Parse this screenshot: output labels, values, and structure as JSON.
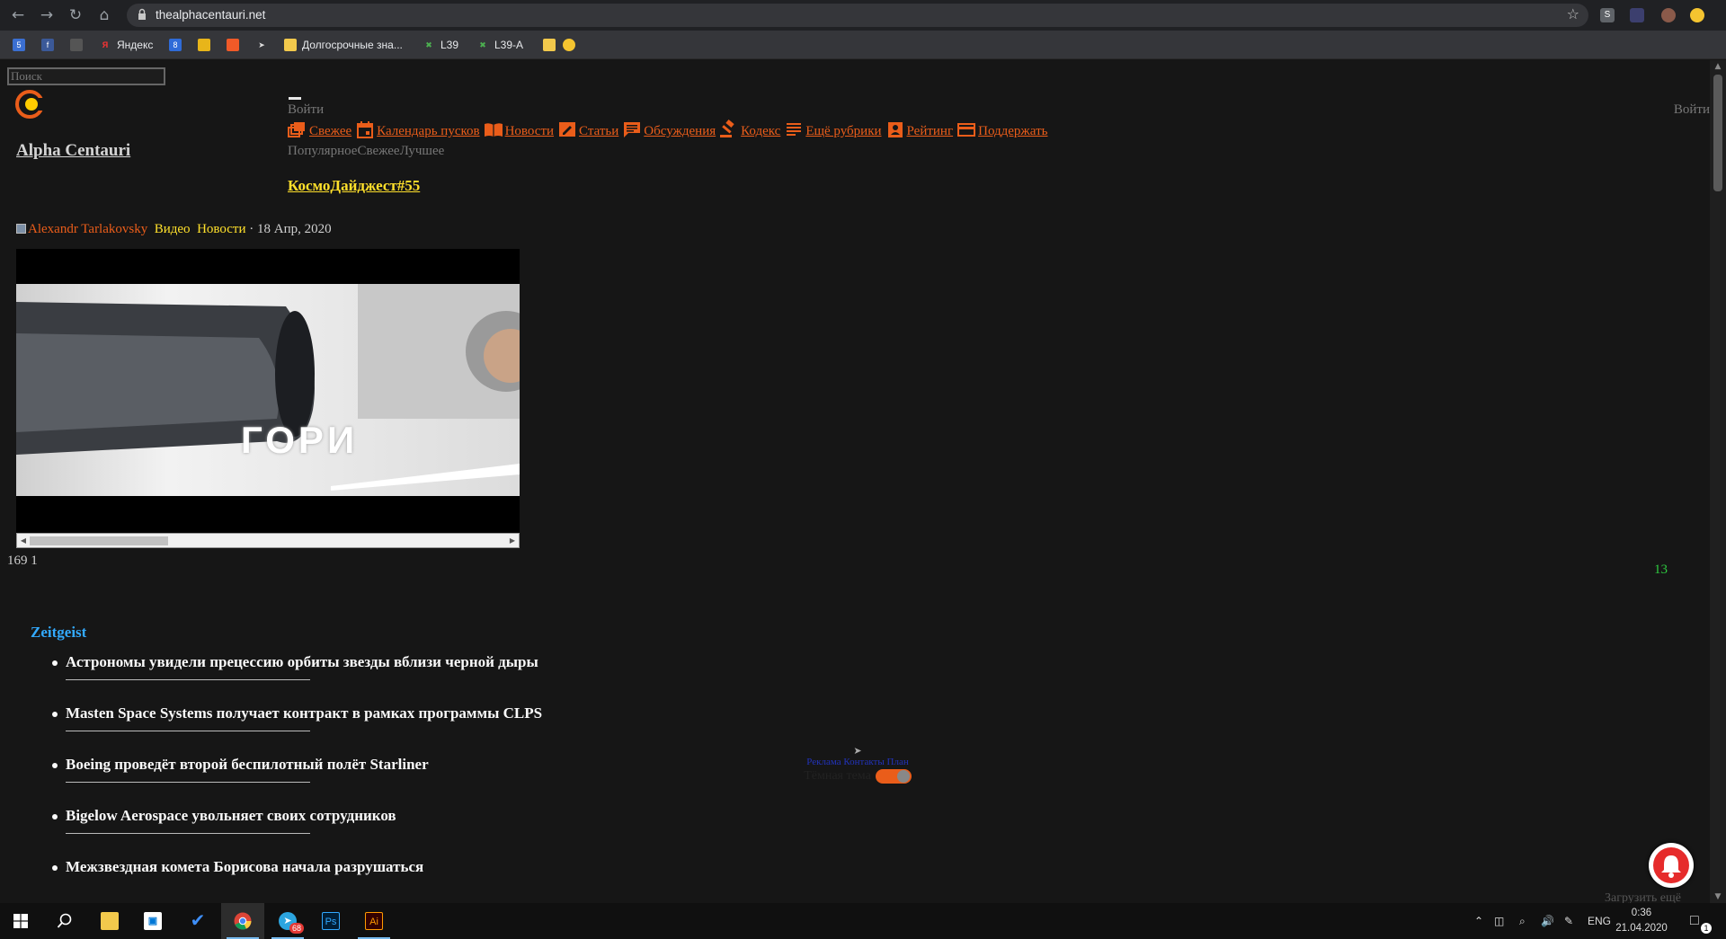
{
  "browser": {
    "url": "thealphacentauri.net",
    "bookmarks": [
      {
        "label": ""
      },
      {
        "label": ""
      },
      {
        "label": ""
      },
      {
        "label": "Яндекс"
      },
      {
        "label": ""
      },
      {
        "label": ""
      },
      {
        "label": ""
      },
      {
        "label": ""
      },
      {
        "label": "Долгосрочные зна..."
      },
      {
        "label": "L39"
      },
      {
        "label": "L39-A"
      },
      {
        "label": ""
      },
      {
        "label": ""
      }
    ]
  },
  "page": {
    "search_placeholder": "Поиск",
    "site_title": "Alpha Centauri",
    "login_left": "Войти",
    "login_right": "Войти",
    "nav": [
      {
        "label": " Свежее",
        "icon": "stack-icon"
      },
      {
        "label": " Календарь пусков",
        "icon": "calendar-icon"
      },
      {
        "label": " Новости",
        "icon": "book-icon"
      },
      {
        "label": " Статьи",
        "icon": "edit-icon"
      },
      {
        "label": " Обсуждения",
        "icon": "chat-icon"
      },
      {
        "label": " Кодекс",
        "icon": "gavel-icon"
      },
      {
        "label": " Ещё рубрики",
        "icon": "list-icon"
      },
      {
        "label": " Рейтинг",
        "icon": "badge-icon"
      },
      {
        "label": " Поддержать",
        "icon": "card-icon"
      }
    ],
    "sort_tabs": "ПопулярноеСвежееЛучшее",
    "article": {
      "title": "КосмоДайджест#55",
      "author": "Alexandr Tarlakovsky",
      "category_1": "Видео",
      "category_2": "Новости",
      "date_sep": " · 18 Апр, 2020",
      "video_text": "ГОРИ",
      "views": "169 ",
      "comments": "1",
      "counter": "13"
    },
    "zeitgeist": {
      "title": "Zeitgeist",
      "items": [
        "Астрономы увидели прецессию орбиты звезды вблизи черной дыры",
        "Masten Space Systems получает контракт в рамках программы CLPS",
        "Boeing проведёт второй беспилотный полёт Starliner",
        "Bigelow Aerospace увольняет своих сотрудников",
        "Межзвездная комета Борисова начала разрушаться"
      ]
    },
    "footer": {
      "links": [
        "Реклама",
        "Контакты",
        "План"
      ],
      "dark_theme": "Тёмная тема",
      "load_more": "Загрузить ещё"
    },
    "colors": {
      "accent": "#ea5d1a",
      "title_yellow": "#ffe02b",
      "zeitgeist_blue": "#33aaff",
      "counter_green": "#2ecc40"
    }
  },
  "taskbar": {
    "apps": [
      "start-icon",
      "search-icon",
      "file-explorer-icon",
      "store-icon",
      "todo-icon",
      "chrome-icon",
      "telegram-icon",
      "photoshop-icon",
      "illustrator-icon"
    ],
    "telegram_badge": "68",
    "language": "ENG",
    "time": "0:36",
    "date": "21.04.2020",
    "notifications": "1"
  }
}
